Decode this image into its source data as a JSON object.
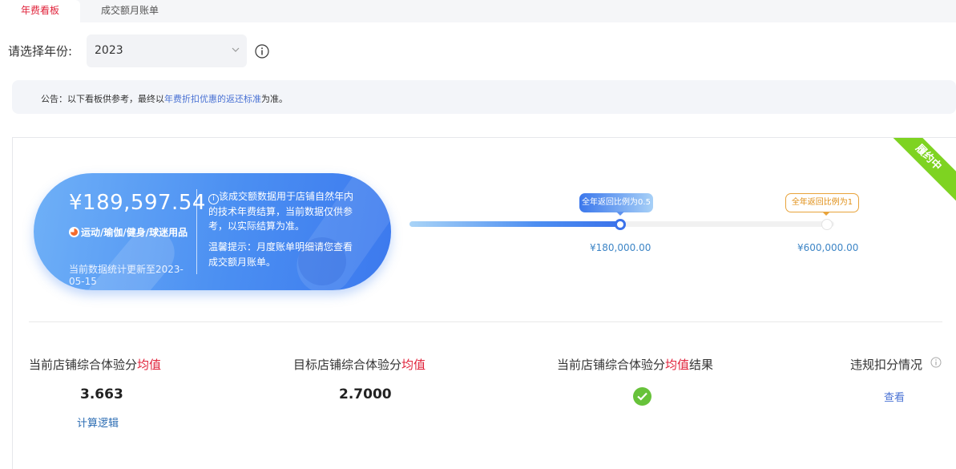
{
  "tabs": [
    {
      "label": "年费看板",
      "active": true
    },
    {
      "label": "成交额月账单",
      "active": false
    }
  ],
  "year_select": {
    "label": "请选择年份:",
    "value": "2023",
    "icon": "chevron-down-icon"
  },
  "notice": {
    "prefix": "公告：以下看板供参考，最终以",
    "link": "年费折扣优惠的返还标准",
    "suffix": "为准。"
  },
  "status_ribbon": "履约中",
  "summary": {
    "amount": "¥189,597.54",
    "category": "运动/瑜伽/健身/球迷用品",
    "update_text": "当前数据统计更新至2023-05-15",
    "description": "该成交额数据用于店铺自然年内的技术年费结算，当前数据仅供参考，以实际结算为准。",
    "hint": "温馨提示：月度账单明细请您查看成交额月账单。"
  },
  "progress": {
    "fill_fraction": 0.5,
    "milestones": [
      {
        "tip": "全年返回比例为0.5",
        "amount": "¥180,000.00",
        "reached": true
      },
      {
        "tip": "全年返回比例为1",
        "amount": "¥600,000.00",
        "reached": false
      }
    ]
  },
  "stats": {
    "current_score": {
      "title_prefix": "当前店铺综合体验分",
      "title_highlight": "均值",
      "value": "3.663",
      "link": "计算逻辑"
    },
    "target_score": {
      "title_prefix": "目标店铺综合体验分",
      "title_highlight": "均值",
      "value": "2.7000"
    },
    "result": {
      "title_prefix": "当前店铺综合体验分",
      "title_highlight": "均值",
      "title_suffix": "结果",
      "status": "passed"
    },
    "violation": {
      "title": "违规扣分情况",
      "link": "查看"
    }
  },
  "colors": {
    "accent_red": "#e0223a",
    "brand_blue": "#3b72ea",
    "success_green": "#67c23a",
    "ribbon_green": "#7ed321"
  }
}
